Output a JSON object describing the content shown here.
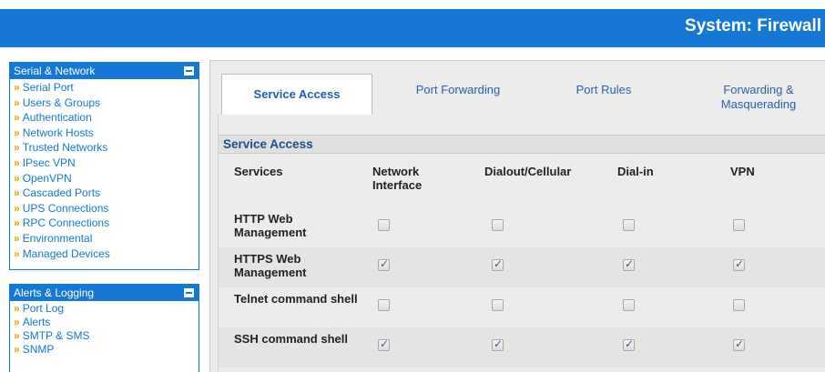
{
  "header": {
    "title": "System: Firewall"
  },
  "menus": [
    {
      "title": "Serial & Network",
      "items": [
        "Serial Port",
        "Users & Groups",
        "Authentication",
        "Network Hosts",
        "Trusted Networks",
        "IPsec VPN",
        "OpenVPN",
        "Cascaded Ports",
        "UPS Connections",
        "RPC Connections",
        "Environmental",
        "Managed Devices"
      ]
    },
    {
      "title": "Alerts & Logging",
      "items": [
        "Port Log",
        "Alerts",
        "SMTP & SMS",
        "SNMP"
      ]
    }
  ],
  "tabs": [
    {
      "label": "Service Access",
      "active": true
    },
    {
      "label": "Port Forwarding",
      "active": false
    },
    {
      "label": "Port Rules",
      "active": false
    },
    {
      "label": "Forwarding & Masquerading",
      "active": false
    }
  ],
  "section": {
    "title": "Service Access"
  },
  "table": {
    "columns": [
      "Services",
      "Network Interface",
      "Dialout/Cellular",
      "Dial-in",
      "VPN"
    ],
    "rows": [
      {
        "label": "HTTP Web Management",
        "checked": [
          false,
          false,
          false,
          false
        ]
      },
      {
        "label": "HTTPS Web Management",
        "checked": [
          true,
          true,
          true,
          true
        ]
      },
      {
        "label": "Telnet command shell",
        "checked": [
          false,
          false,
          false,
          false
        ]
      },
      {
        "label": "SSH command shell",
        "checked": [
          true,
          true,
          true,
          true
        ]
      }
    ]
  },
  "colors": {
    "header_blue": "#1478d4",
    "link_blue": "#1478d4",
    "arrow_orange": "#e8a000"
  }
}
